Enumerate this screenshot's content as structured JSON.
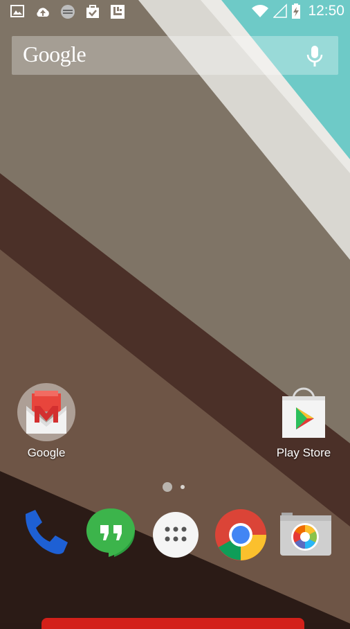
{
  "status_bar": {
    "time": "12:50",
    "notification_icons": [
      "image-icon",
      "cloud-upload-icon",
      "sync-icon",
      "task-done-icon",
      "launcher-icon"
    ],
    "system_icons": [
      "wifi-icon",
      "cell-signal-icon",
      "battery-charging-icon"
    ]
  },
  "search": {
    "brand": "Google",
    "mic_icon": "mic-icon"
  },
  "home_apps": [
    {
      "label": "Google",
      "icon": "gmail-folder-icon"
    },
    {
      "label": "Play Store",
      "icon": "play-store-icon"
    }
  ],
  "page_indicator": {
    "pages": 2,
    "current": 1
  },
  "dock": {
    "items": [
      "phone-icon",
      "hangouts-icon",
      "app-drawer-icon",
      "chrome-icon",
      "camera-icon"
    ]
  },
  "colors": {
    "wallpaper_sky": "#6ec9c6",
    "wallpaper_beige": "#857a6c",
    "wallpaper_dark": "#3b2420",
    "navbar_red": "#d3201a"
  }
}
